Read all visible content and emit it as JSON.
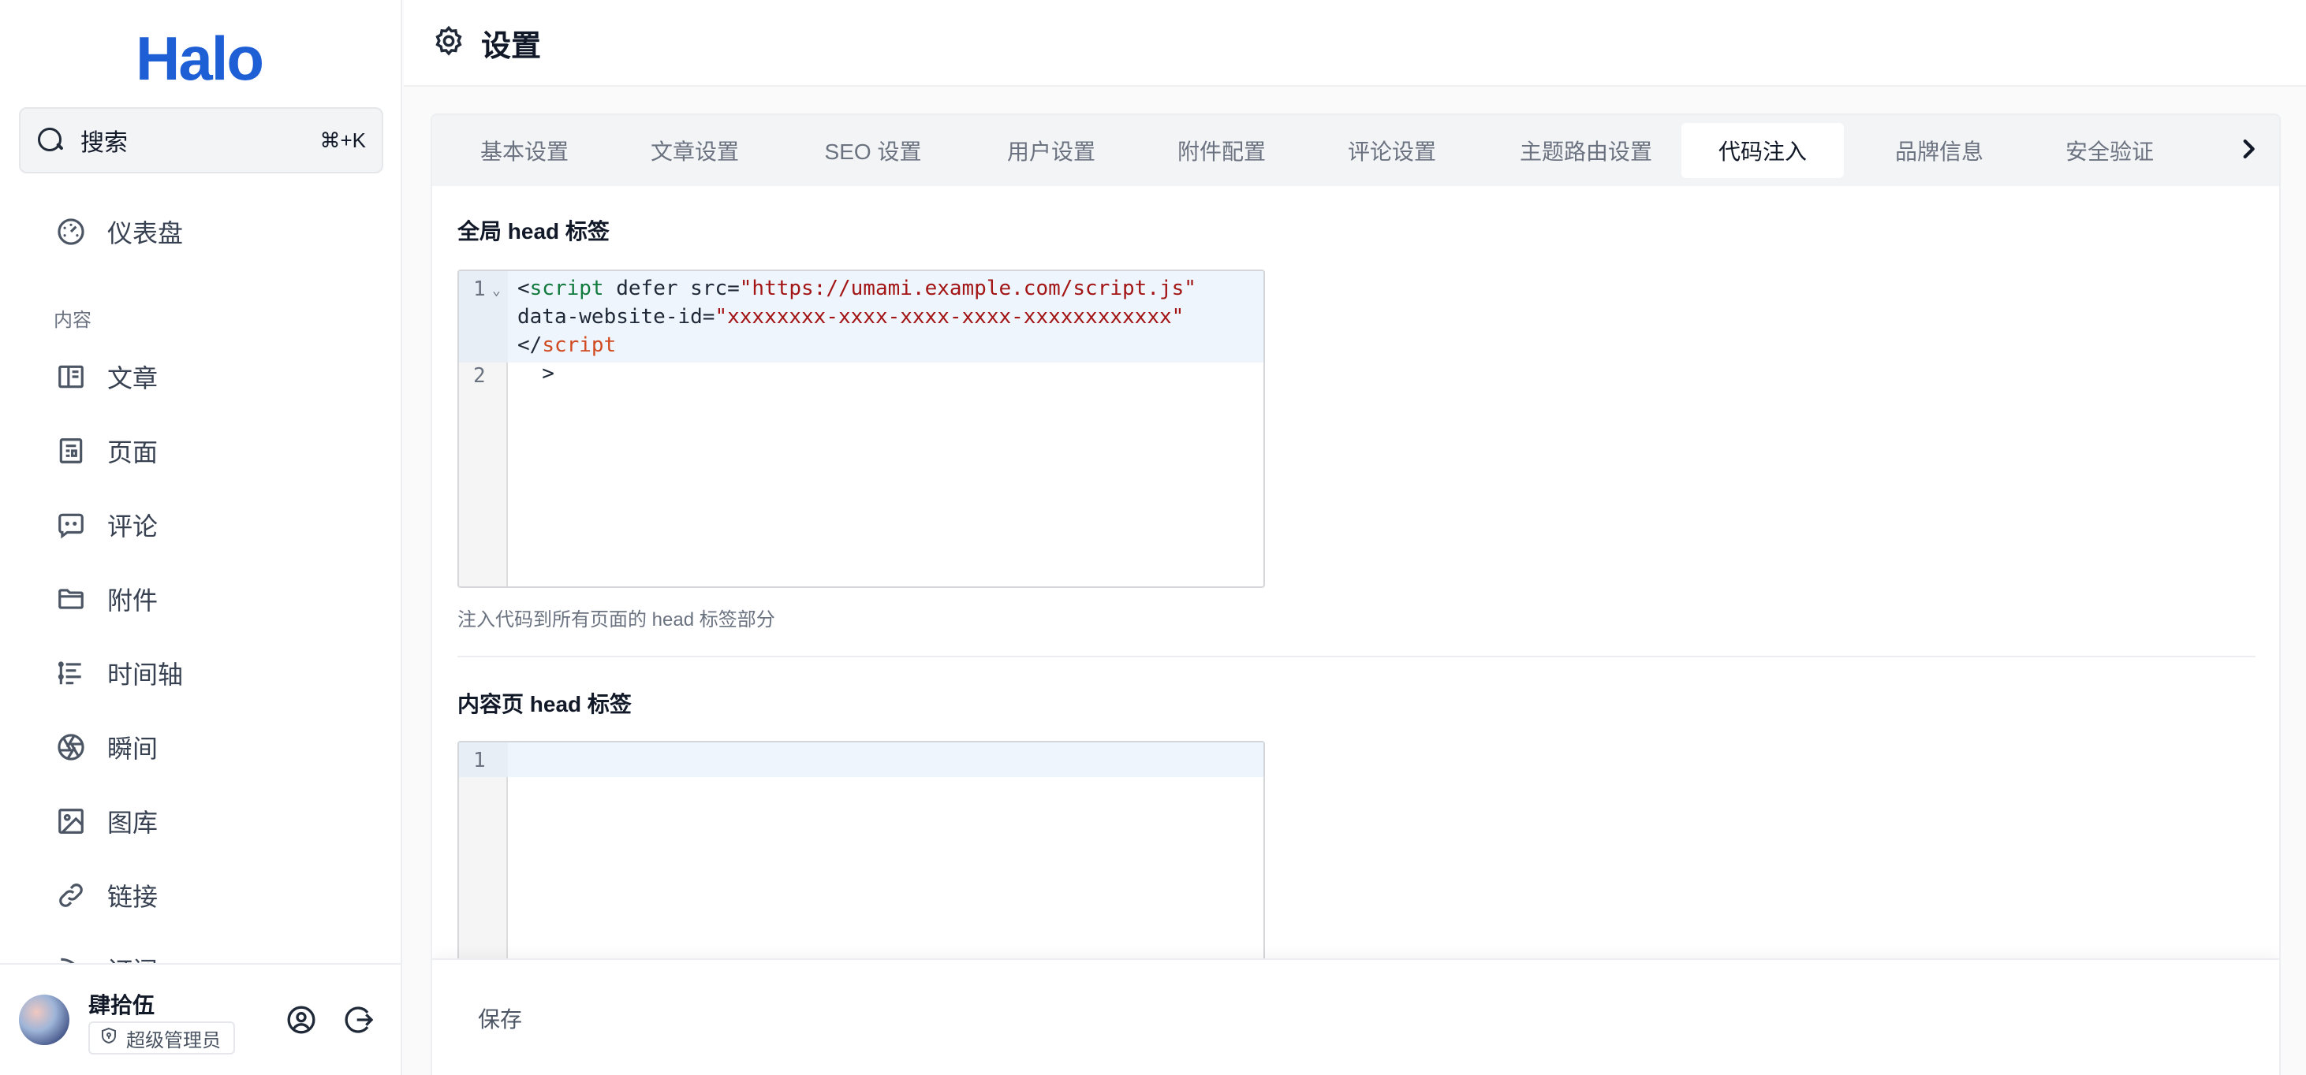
{
  "sidebar": {
    "logo": "Halo",
    "search": {
      "label": "搜索",
      "shortcut": "⌘+K"
    },
    "dashboard": "仪表盘",
    "section_content": "内容",
    "items": [
      {
        "label": "文章",
        "icon": "book-open-icon"
      },
      {
        "label": "页面",
        "icon": "file-layout-icon"
      },
      {
        "label": "评论",
        "icon": "chat-bubble-icon"
      },
      {
        "label": "附件",
        "icon": "folder-icon"
      },
      {
        "label": "时间轴",
        "icon": "timeline-icon"
      },
      {
        "label": "瞬间",
        "icon": "aperture-icon"
      },
      {
        "label": "图库",
        "icon": "image-icon"
      },
      {
        "label": "链接",
        "icon": "link-icon"
      },
      {
        "label": "订阅",
        "icon": "rss-icon"
      }
    ],
    "user": {
      "name": "肆拾伍",
      "role": "超级管理员"
    }
  },
  "header": {
    "title": "设置"
  },
  "tabs": [
    {
      "label": "基本设置",
      "active": false
    },
    {
      "label": "文章设置",
      "active": false
    },
    {
      "label": "SEO 设置",
      "active": false
    },
    {
      "label": "用户设置",
      "active": false
    },
    {
      "label": "附件配置",
      "active": false
    },
    {
      "label": "评论设置",
      "active": false
    },
    {
      "label": "主题路由设置",
      "active": false
    },
    {
      "label": "代码注入",
      "active": true
    },
    {
      "label": "品牌信息",
      "active": false
    },
    {
      "label": "安全验证",
      "active": false
    }
  ],
  "fields": {
    "global_head": {
      "label": "全局 head 标签",
      "help": "注入代码到所有页面的 head 标签部分",
      "code": {
        "open_bracket": "<",
        "tag": "script",
        "attr1": " defer src=",
        "src": "\"https://umami.example.com/script.js\"",
        "attr2": "data-website-id=",
        "website_id": "\"xxxxxxxx-xxxx-xxxx-xxxx-xxxxxxxxxxxx\"",
        "close_prefix": "</",
        "close_tag": "script",
        "line2": "  >"
      }
    },
    "content_head": {
      "label": "内容页 head 标签"
    }
  },
  "footer": {
    "save_label": "保存"
  },
  "colors": {
    "brand": "#1f5fd6",
    "active_tab_bg": "#ffffff",
    "tab_bar_bg": "#f3f4f6"
  }
}
